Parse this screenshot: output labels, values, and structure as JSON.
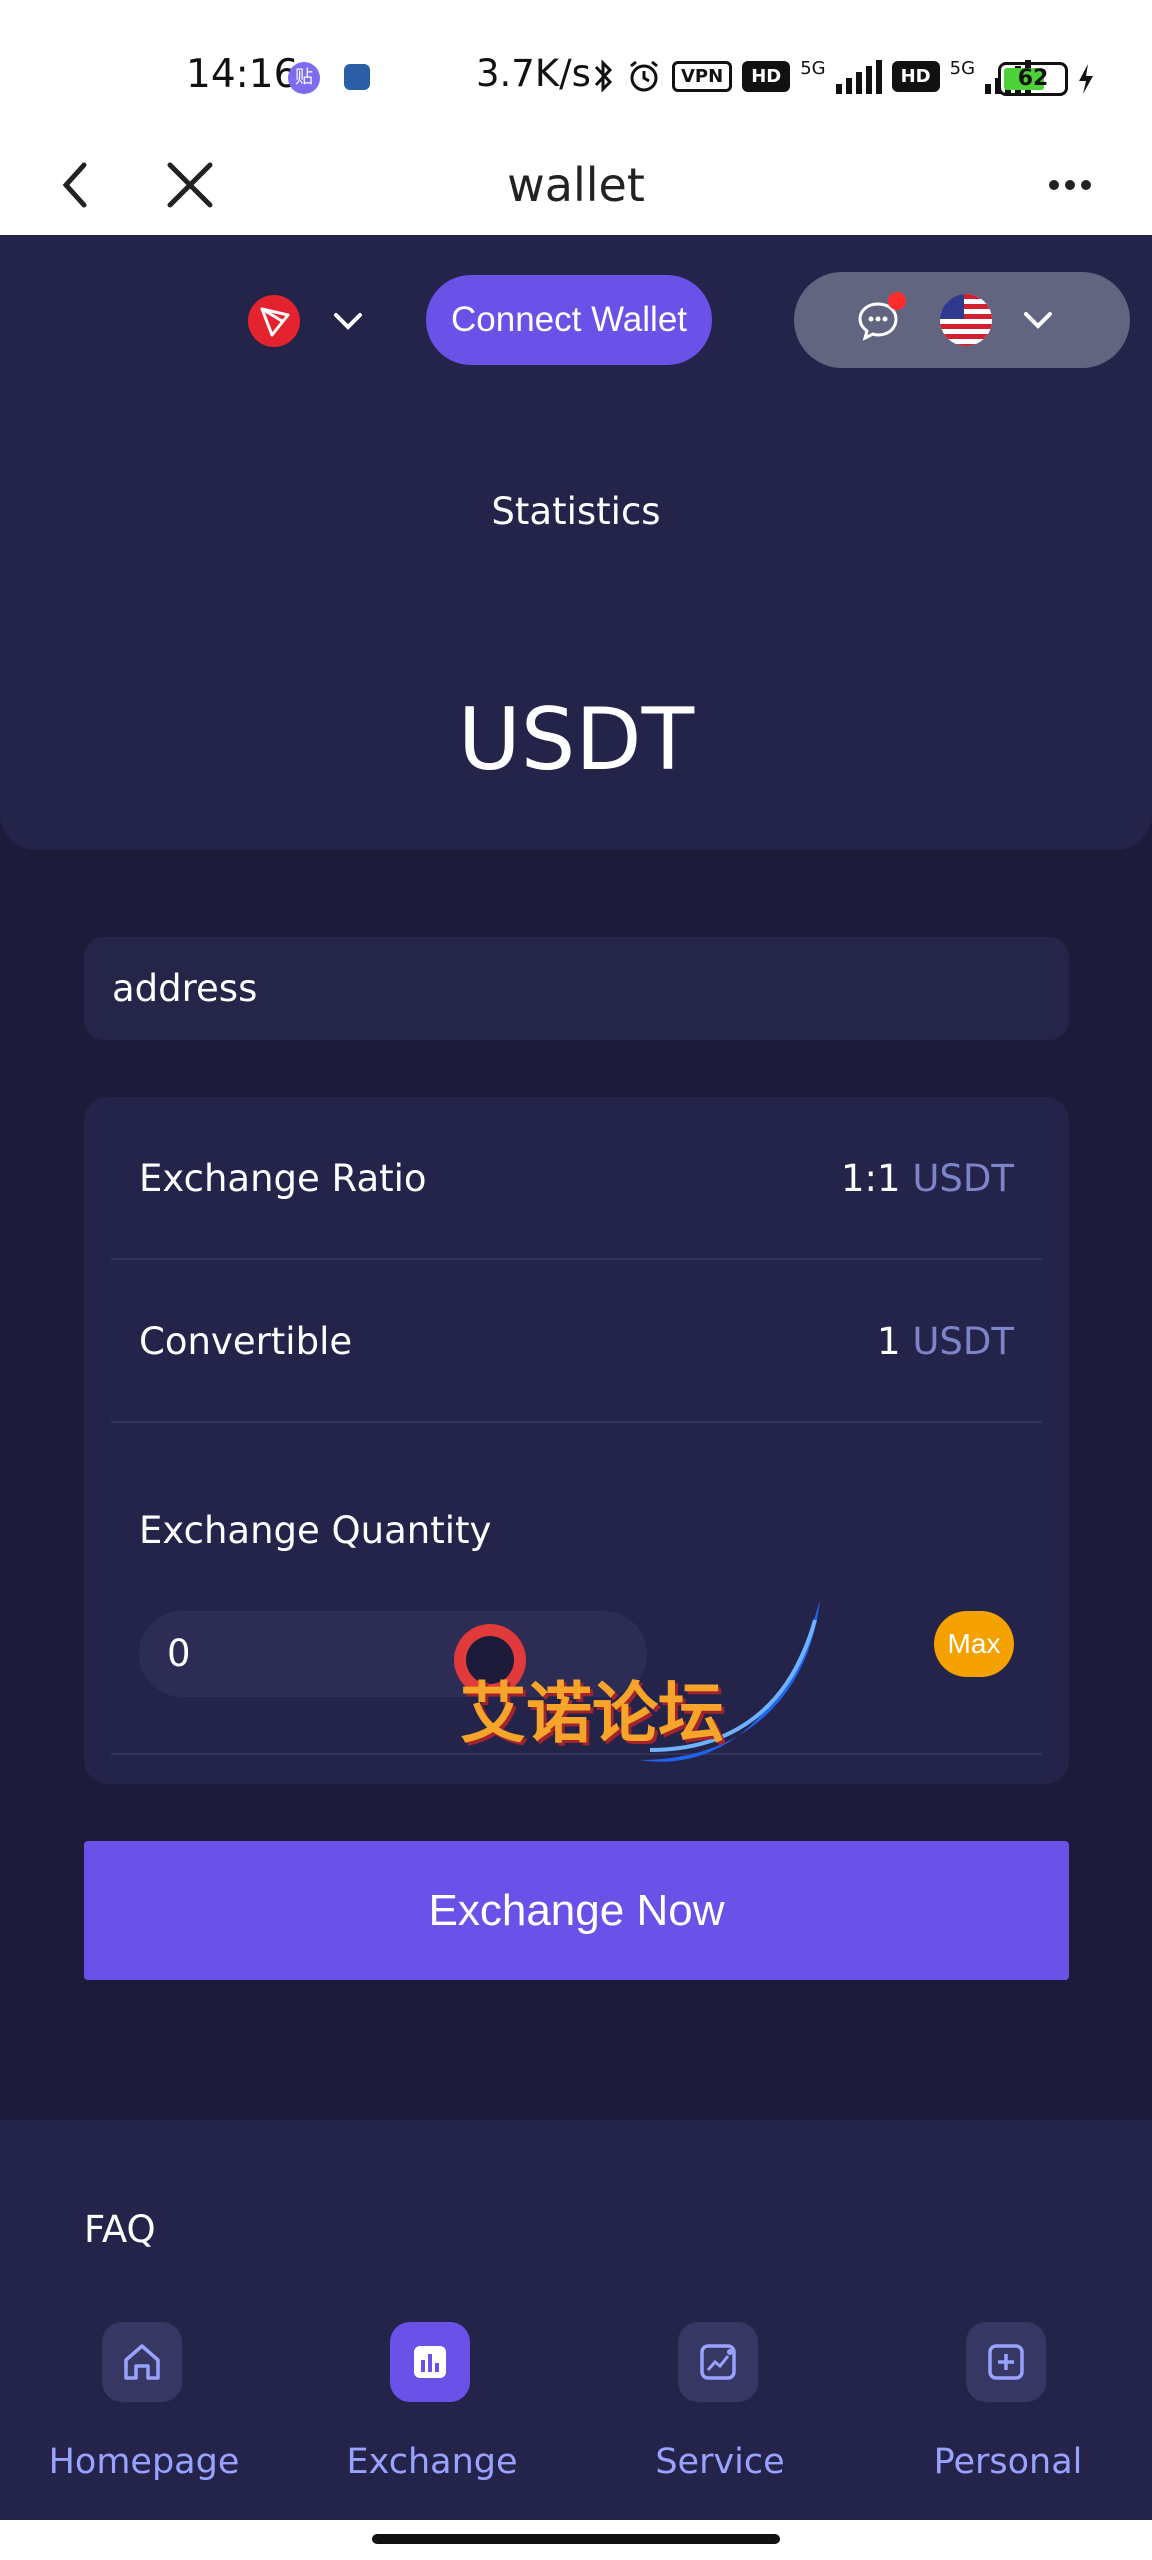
{
  "status_bar": {
    "time": "14:16",
    "app1_badge": "贴",
    "net_speed": "3.7K/s",
    "vpn": "VPN",
    "hd1": "HD",
    "net1": "5G",
    "hd2": "HD",
    "net2": "5G",
    "battery": "62"
  },
  "title_bar": {
    "title": "wallet"
  },
  "header": {
    "connect_label": "Connect Wallet",
    "stats_label": "Statistics",
    "token": "USDT"
  },
  "form": {
    "address_placeholder": "address",
    "rows": [
      {
        "label": "Exchange Ratio",
        "value": "1:1",
        "unit": "USDT"
      },
      {
        "label": "Convertible",
        "value": "1",
        "unit": "USDT"
      }
    ],
    "quantity_label": "Exchange Quantity",
    "quantity_value": "0",
    "max_label": "Max",
    "submit_label": "Exchange Now"
  },
  "watermark": "艾诺论坛",
  "faq_label": "FAQ",
  "nav": [
    {
      "label": "Homepage",
      "icon": "home-icon",
      "active": false
    },
    {
      "label": "Exchange",
      "icon": "exchange-chart-icon",
      "active": true
    },
    {
      "label": "Service",
      "icon": "service-icon",
      "active": false
    },
    {
      "label": "Personal",
      "icon": "personal-plus-icon",
      "active": false
    }
  ],
  "colors": {
    "accent": "#6a52e8",
    "background": "#1c1c3a",
    "panel": "#24244a",
    "max_button": "#f5a100",
    "unit_text": "#7d84c8",
    "nav_text": "#9aa2ff"
  }
}
